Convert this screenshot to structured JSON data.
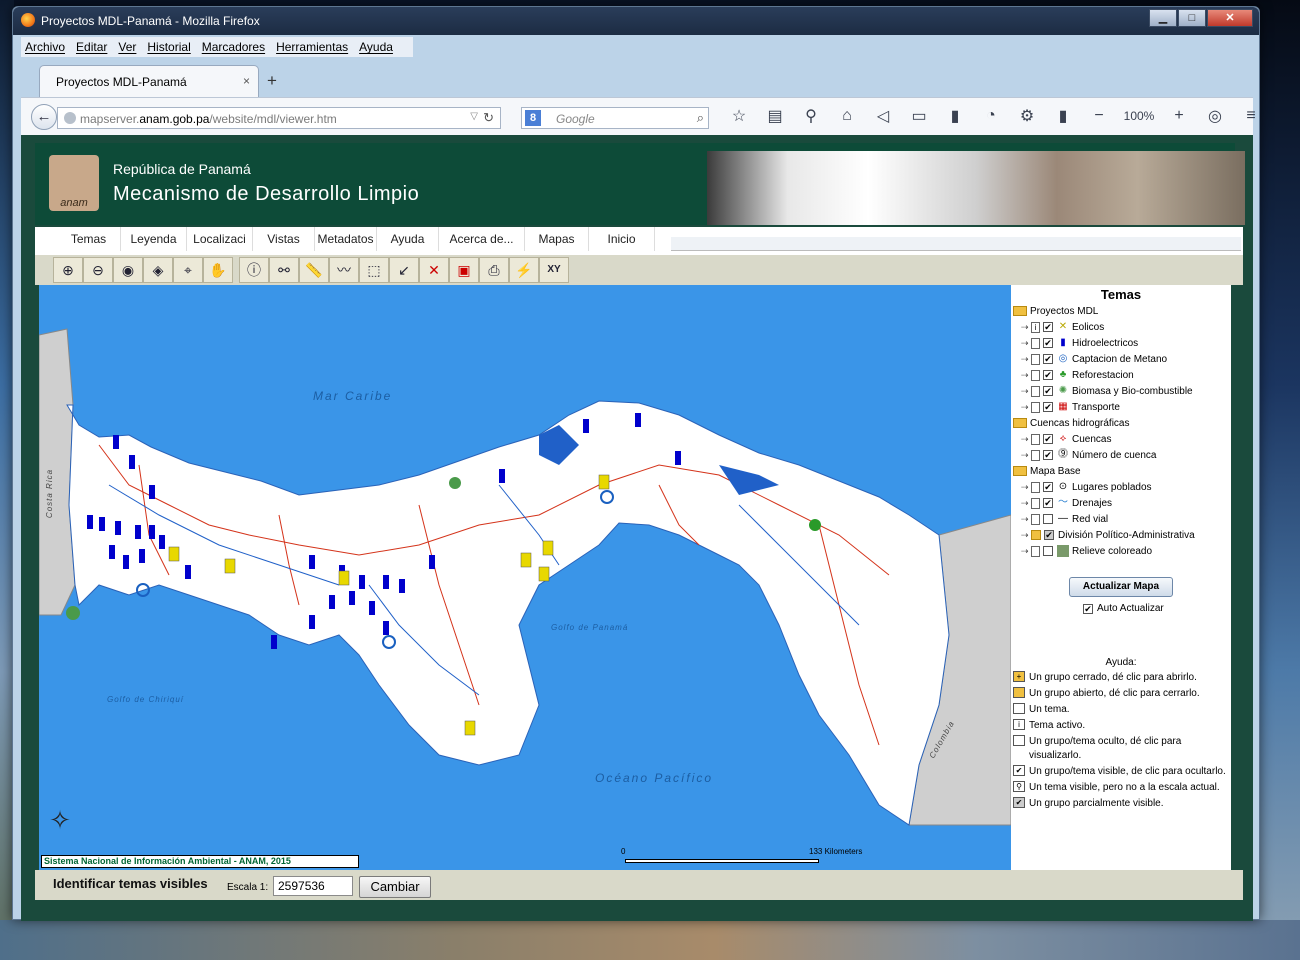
{
  "window": {
    "title": "Proyectos MDL-Panamá - Mozilla Firefox",
    "buttons": {
      "minimize": "▁",
      "maximize": "□",
      "close": "✕"
    }
  },
  "menu": [
    "Archivo",
    "Editar",
    "Ver",
    "Historial",
    "Marcadores",
    "Herramientas",
    "Ayuda"
  ],
  "tab": {
    "label": "Proyectos MDL-Panamá",
    "close": "×",
    "new": "+"
  },
  "nav": {
    "url_prefix": "mapserver.",
    "url_domain": "anam.gob.pa",
    "url_path": "/website/mdl/viewer.htm",
    "search_engine": "8",
    "search_placeholder": "Google",
    "zoom": "100%"
  },
  "banner": {
    "logo_text": "anam",
    "republica": "República de Panamá",
    "mecanismo": "Mecanismo de Desarrollo Limpio"
  },
  "nav_tabs": [
    "Temas",
    "Leyenda",
    "Localizaci",
    "Vistas",
    "Metadatos",
    "Ayuda",
    "Acerca de...",
    "Mapas",
    "Inicio"
  ],
  "tools": [
    "zoom-in",
    "zoom-out",
    "full-extent",
    "zoom-active",
    "zoom-previous",
    "pan",
    "identify",
    "find",
    "measure",
    "buffer",
    "select-rect",
    "select-line",
    "clear",
    "pdf",
    "print",
    "hyperlink",
    "xy"
  ],
  "map": {
    "labels": {
      "mar_caribe": "Mar Caribe",
      "oceano_pacifico": "Océano Pacífico",
      "golfo_panama": "Golfo de Panamá",
      "golfo_chiriqui": "Golfo de Chiriquí",
      "costa_rica": "Costa Rica",
      "colombia": "Colombia"
    },
    "credit": "Sistema Nacional de Información Ambiental - ANAM, 2015",
    "scale_zero": "0",
    "scale_km": "133  Kilometers"
  },
  "panel": {
    "title": "Temas",
    "groups": [
      {
        "name": "Proyectos MDL",
        "items": [
          "Eolicos",
          "Hidroelectricos",
          "Captacion de Metano",
          "Reforestacion",
          "Biomasa y Bio-combustible",
          "Transporte"
        ]
      },
      {
        "name": "Cuencas hidrográficas",
        "items": [
          "Cuencas",
          "Número de cuenca"
        ]
      },
      {
        "name": "Mapa Base",
        "items": [
          "Lugares poblados",
          "Drenajes",
          "Red vial",
          "División Político-Administrativa",
          "Relieve coloreado"
        ]
      }
    ],
    "update_button": "Actualizar Mapa",
    "auto_update": "Auto Actualizar",
    "help_title": "Ayuda:",
    "help": [
      "Un grupo cerrado, dé clic para abrirlo.",
      "Un grupo abierto, dé clic para cerrarlo.",
      "Un tema.",
      "Tema activo.",
      "Un grupo/tema oculto, dé clic para visualizarlo.",
      "Un grupo/tema visible, de clic para ocultarlo.",
      "Un tema visible, pero no a la escala actual.",
      "Un grupo parcialmente visible."
    ]
  },
  "bottom": {
    "identify": "Identificar temas visibles",
    "scale_label": "Escala 1:",
    "scale_value": "2597536",
    "change_button": "Cambiar"
  }
}
